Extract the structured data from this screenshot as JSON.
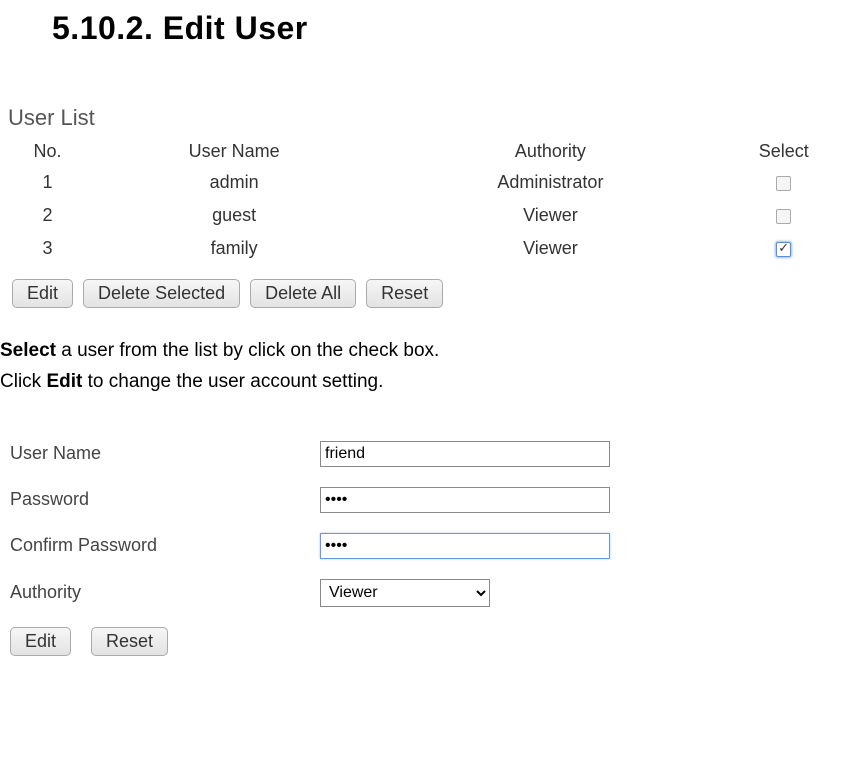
{
  "heading": "5.10.2. Edit User",
  "userList": {
    "title": "User List",
    "columns": [
      "No.",
      "User Name",
      "Authority",
      "Select"
    ],
    "rows": [
      {
        "no": "1",
        "name": "admin",
        "authority": "Administrator",
        "selected": false
      },
      {
        "no": "2",
        "name": "guest",
        "authority": "Viewer",
        "selected": false
      },
      {
        "no": "3",
        "name": "family",
        "authority": "Viewer",
        "selected": true
      }
    ],
    "buttons": {
      "edit": "Edit",
      "deleteSelected": "Delete Selected",
      "deleteAll": "Delete All",
      "reset": "Reset"
    }
  },
  "instructions": {
    "line1_bold": "Select",
    "line1_rest": " a user from the list by click on the check box.",
    "line2_pre": "Click ",
    "line2_bold": "Edit",
    "line2_rest": " to change the user account setting."
  },
  "form": {
    "userNameLabel": "User Name",
    "userNameValue": "friend",
    "passwordLabel": "Password",
    "passwordValue": "••••",
    "confirmPasswordLabel": "Confirm Password",
    "confirmPasswordValue": "••••",
    "authorityLabel": "Authority",
    "authorityValue": "Viewer",
    "buttons": {
      "edit": "Edit",
      "reset": "Reset"
    }
  }
}
